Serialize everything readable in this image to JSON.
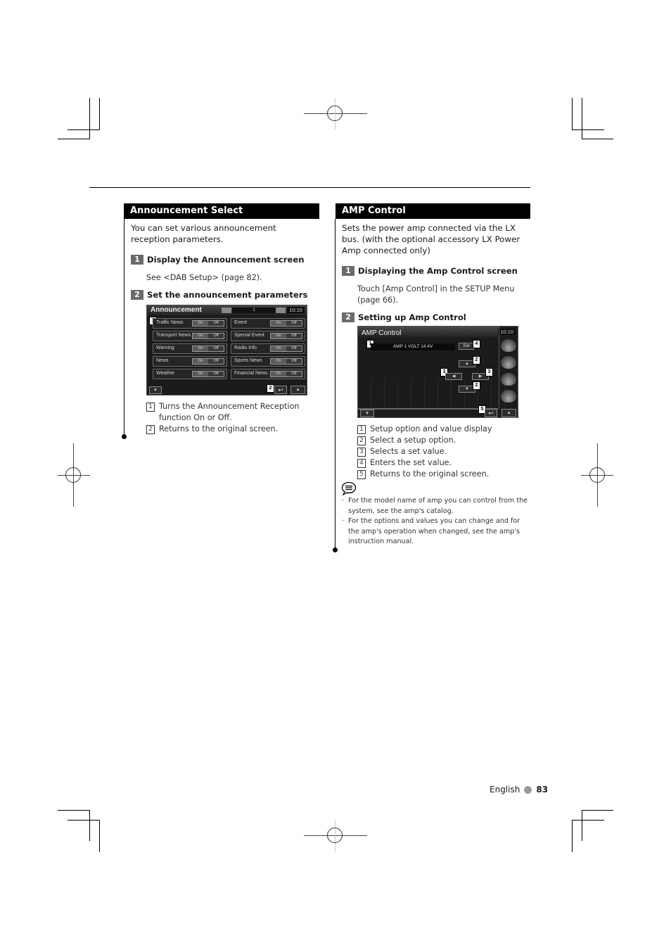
{
  "left": {
    "section_title": "Announcement Select",
    "intro": "You can set various announcement reception parameters.",
    "steps": [
      {
        "num": "1",
        "title": "Display the Announcement screen",
        "text": "See <DAB Setup> (page 82)."
      },
      {
        "num": "2",
        "title": "Set the announcement parameters"
      }
    ],
    "screen": {
      "title": "Announcement",
      "page": "1",
      "clock": "10:10",
      "rows_left": [
        "Traffic News",
        "Transport News",
        "Warning",
        "News",
        "Weather"
      ],
      "rows_right": [
        "Event",
        "Special Event",
        "Radio Info",
        "Sports News",
        "Financial News"
      ],
      "toggle_on": "On",
      "toggle_off": "Off",
      "badges": [
        "1",
        "2"
      ]
    },
    "legend": [
      {
        "num": "1",
        "text": "Turns the Announcement Reception function On or Off."
      },
      {
        "num": "2",
        "text": "Returns to the original screen."
      }
    ]
  },
  "right": {
    "section_title": "AMP Control",
    "intro": "Sets the power amp connected via the LX bus. (with the optional accessory LX Power Amp connected only)",
    "steps": [
      {
        "num": "1",
        "title": "Displaying the Amp Control screen",
        "text": "Touch [Amp Control] in the SETUP Menu (page 66)."
      },
      {
        "num": "2",
        "title": "Setting up Amp Control"
      }
    ],
    "screen": {
      "title": "AMP Control",
      "clock": "10:10",
      "value_display": "AMP 1 VOLT 14.4V",
      "set_label": "Set",
      "badges": [
        "1",
        "4",
        "2",
        "3",
        "3",
        "2",
        "5"
      ]
    },
    "legend": [
      {
        "num": "1",
        "text": "Setup option and value display"
      },
      {
        "num": "2",
        "text": "Select a setup option."
      },
      {
        "num": "3",
        "text": "Selects a set value."
      },
      {
        "num": "4",
        "text": "Enters the set value."
      },
      {
        "num": "5",
        "text": "Returns to the original screen."
      }
    ],
    "notes": [
      "For the model name of amp you can control from the system, see the amp's catalog.",
      "For the options and values you can change and for the amp's operation when changed, see the amp's instruction manual."
    ]
  },
  "footer": {
    "language": "English",
    "page_number": "83"
  }
}
